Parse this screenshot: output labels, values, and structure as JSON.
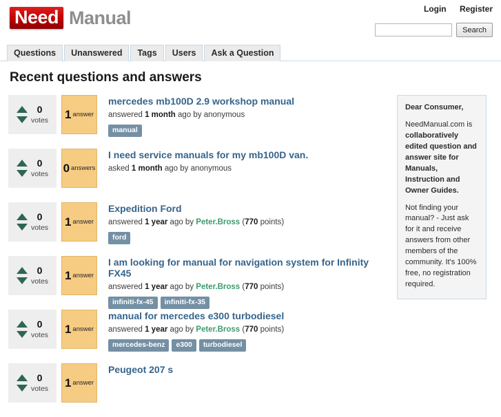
{
  "header": {
    "logo_badge": "Need",
    "logo_word": "Manual",
    "login_label": "Login",
    "register_label": "Register",
    "search_value": "",
    "search_placeholder": "",
    "search_button_label": "Search"
  },
  "nav": {
    "tabs": [
      {
        "label": "Questions"
      },
      {
        "label": "Unanswered"
      },
      {
        "label": "Tags"
      },
      {
        "label": "Users"
      },
      {
        "label": "Ask a Question"
      }
    ]
  },
  "main": {
    "page_title": "Recent questions and answers",
    "vote_label": "votes",
    "questions": [
      {
        "votes": "0",
        "answer_count": "1",
        "answer_label": "answer",
        "title": "mercedes mb100D 2.9 workshop manual",
        "action": "answered",
        "age": "1 month",
        "ago_by": "ago by",
        "author": "anonymous",
        "author_is_link": false,
        "points": "",
        "tags": [
          "manual"
        ]
      },
      {
        "votes": "0",
        "answer_count": "0",
        "answer_label": "answers",
        "title": "I need service manuals for my mb100D van.",
        "action": "asked",
        "age": "1 month",
        "ago_by": "ago by",
        "author": "anonymous",
        "author_is_link": false,
        "points": "",
        "tags": []
      },
      {
        "votes": "0",
        "answer_count": "1",
        "answer_label": "answer",
        "title": "Expedition Ford",
        "action": "answered",
        "age": "1 year",
        "ago_by": "ago by",
        "author": "Peter.Bross",
        "author_is_link": true,
        "points": "770",
        "tags": [
          "ford"
        ]
      },
      {
        "votes": "0",
        "answer_count": "1",
        "answer_label": "answer",
        "title": "I am looking for manual for navigation system for Infinity FX45",
        "action": "answered",
        "age": "1 year",
        "ago_by": "ago by",
        "author": "Peter.Bross",
        "author_is_link": true,
        "points": "770",
        "tags": [
          "infiniti-fx-45",
          "infiniti-fx-35"
        ]
      },
      {
        "votes": "0",
        "answer_count": "1",
        "answer_label": "answer",
        "title": "manual for mercedes e300 turbodiesel",
        "action": "answered",
        "age": "1 year",
        "ago_by": "ago by",
        "author": "Peter.Bross",
        "author_is_link": true,
        "points": "770",
        "tags": [
          "mercedes-benz",
          "e300",
          "turbodiesel"
        ]
      },
      {
        "votes": "0",
        "answer_count": "1",
        "answer_label": "answer",
        "title": "Peugeot 207 s",
        "action": "",
        "age": "",
        "ago_by": "",
        "author": "",
        "author_is_link": false,
        "points": "",
        "tags": []
      }
    ],
    "points_suffix": "points"
  },
  "sidebar": {
    "greeting": "Dear Consumer,",
    "paragraph1_lead": "NeedManual.com is ",
    "paragraph1_bold": "collaboratively edited question and answer site for Manuals, Instruction and Owner Guides.",
    "paragraph2": "Not finding your manual? - Just ask for it and receive answers from other members of the community. It's 100% free, no registration required."
  },
  "colors": {
    "brand_red": "#c00000",
    "title_blue": "#36648b",
    "user_green": "#3a9c6e",
    "tag_slate": "#7490a4",
    "answer_tan": "#f6cc83",
    "vote_arrow": "#2e6656"
  }
}
